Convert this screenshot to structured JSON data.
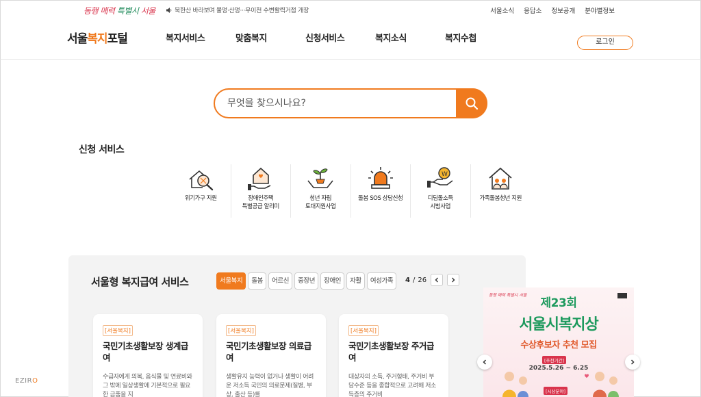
{
  "topbar": {
    "slogan": [
      "동행 매력",
      " 특별시 ",
      "서울"
    ],
    "notice": "북한산 바라보며 물멍·산멍···우이천 수변활력거점 개장",
    "utils": [
      "서울소식",
      "응답소",
      "정보공개",
      "분야별정보"
    ]
  },
  "header": {
    "logo_a": "서울",
    "logo_b": "복지",
    "logo_c": "포털",
    "nav": [
      "복지서비스",
      "맞춤복지",
      "신청서비스",
      "복지소식",
      "복지수첩"
    ],
    "login": "로그인"
  },
  "search": {
    "placeholder": "무엇을 찾으시나요?",
    "icon": "search-icon"
  },
  "apply": {
    "title": "신청 서비스",
    "items": [
      {
        "label": "위기가구 지원",
        "icon": "house-magnifier-icon"
      },
      {
        "label": "장애인주택\n특별공급 알리미",
        "icon": "house-hand-icon"
      },
      {
        "label": "청년 자립\n토대지원사업",
        "icon": "sprout-hands-icon"
      },
      {
        "label": "돌봄 SOS 상담신청",
        "icon": "siren-icon"
      },
      {
        "label": "디딤돌소득\n시범사업",
        "icon": "coin-hand-icon"
      },
      {
        "label": "가족돌봄청년 지원",
        "icon": "family-house-icon"
      }
    ]
  },
  "welfare": {
    "title": "서울형 복지급여 서비스",
    "tabs": [
      "서울복지",
      "돌봄",
      "어르신",
      "중장년",
      "장애인",
      "자활",
      "여성가족"
    ],
    "active_tab": 0,
    "page_current": "4",
    "page_sep": " / ",
    "page_total": "26",
    "cards": [
      {
        "tag": "[서울복지]",
        "title": "국민기초생활보장 생계급여",
        "desc": "수급자에게 의복, 음식물 및 연료비와 그 밖에 일상생활에 기본적으로 필요한 금품을 지"
      },
      {
        "tag": "[서울복지]",
        "title": "국민기초생활보장 의료급여",
        "desc": "생활유지 능력이 없거나 생활이 어려운 저소득 국민의 의료문제(질병, 부상, 출산 등)를"
      },
      {
        "tag": "[서울복지]",
        "title": "국민기초생활보장 주거급여",
        "desc": "대상자의 소득, 주거형태, 주거비 부담수준 등을 종합적으로 고려해 저소득층의 주거비"
      }
    ]
  },
  "banner": {
    "logo": "동행 매력 특별시 서울",
    "line1": "제23회",
    "line2": "서울시복지상",
    "line3": "수상후보자 추천 모집",
    "period_label": "[추천기간]",
    "period": "2025.5.26 ~ 6.25",
    "field_label": "[시상분야]"
  },
  "watermark": {
    "a": "EZIR",
    "b": "O"
  },
  "colors": {
    "accent": "#f07a1e",
    "green": "#1e9a5e",
    "red": "#d9344c"
  }
}
